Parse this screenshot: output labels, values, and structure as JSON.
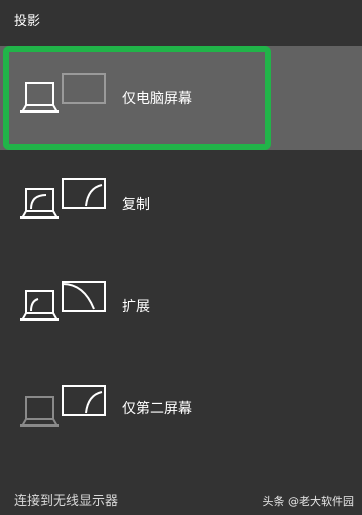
{
  "panel": {
    "title": "投影",
    "items": [
      {
        "label": "仅电脑屏幕",
        "selected": true
      },
      {
        "label": "复制"
      },
      {
        "label": "扩展"
      },
      {
        "label": "仅第二屏幕"
      }
    ],
    "connect_link": "连接到无线显示器"
  },
  "watermark": "头条 @老大软件园",
  "colors": {
    "background": "#333333",
    "selected": "#626262",
    "highlight": "#21b449"
  }
}
